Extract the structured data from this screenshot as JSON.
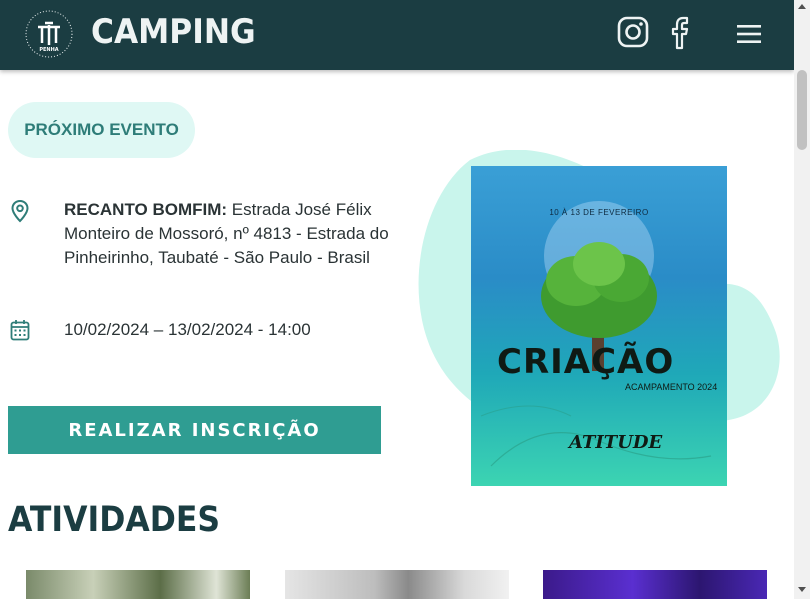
{
  "header": {
    "brand": "CAMPING",
    "logo": {
      "top_text": "MINISTÉRIO",
      "bottom_text": "ATITUDE",
      "center_text": "PENHA"
    },
    "icons": [
      "instagram-icon",
      "facebook-icon",
      "hamburger-menu-icon"
    ]
  },
  "event": {
    "badge": "PRÓXIMO EVENTO",
    "location_label": "RECANTO BOMFIM:",
    "location_text": " Estrada José Félix Monteiro de Mossoró, nº 4813 - Estrada do Pinheirinho, Taubaté - São Paulo - Brasil",
    "date_text": "10/02/2024 – 13/02/2024 - 14:00",
    "cta_label": "REALIZAR INSCRIÇÃO"
  },
  "poster": {
    "date": "10 À 13 DE FEVEREIRO",
    "title": "CRIAÇÃO",
    "subtitle": "ACAMPAMENTO 2024",
    "brand": "ATITUDE"
  },
  "activities": {
    "title": "ATIVIDADES"
  },
  "colors": {
    "header_bg": "#1b3d42",
    "accent": "#2f9d92",
    "pill_bg": "#dff8f4",
    "blob": "#c9f5ec"
  }
}
